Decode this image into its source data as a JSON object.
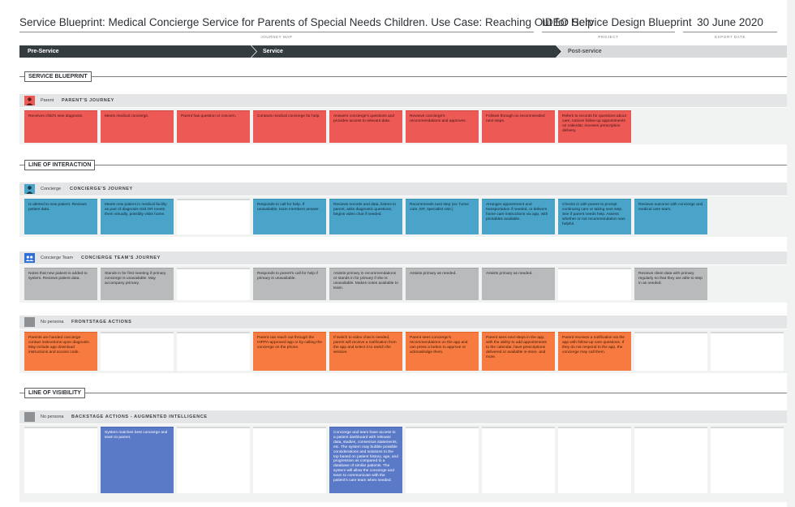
{
  "header": {
    "title": "Service Blueprint: Medical Concierge Service for Parents of Special Needs Children. Use Case: Reaching Out for Help",
    "title_caption": "JOURNEY MAP",
    "project": "IDEO Service Design Blueprint",
    "project_caption": "PROJECT",
    "date": "30 June 2020",
    "date_caption": "EXPORT DATE"
  },
  "phases": {
    "pre": "Pre-Service",
    "service": "Service",
    "post": "Post-service"
  },
  "sections": {
    "service_blueprint": "SERVICE BLUEPRINT",
    "line_of_interaction": "LINE OF INTERACTION",
    "line_of_visibility": "LINE OF VISIBILITY"
  },
  "lanes": {
    "parent": {
      "persona": "Parent",
      "title": "PARENT'S JOURNEY",
      "icon": "parent-avatar-icon",
      "color": "#ed5a56",
      "cards": [
        "Receives child's new diagnosis.",
        "Meets medical concierge.",
        "Parent has question or concern.",
        "Contacts medical concierge for help.",
        "Answers concierge's questions and provides access to relevant data.",
        "Reviews concierge's recommendations and approves.",
        "Follows through on recommended next steps.",
        "Refers to records for questions about care, notices follow-up appointments on calendar, receives prescription delivery."
      ]
    },
    "concierge": {
      "persona": "Concierge",
      "title": "CONCIERGE'S JOURNEY",
      "icon": "concierge-avatar-icon",
      "color": "#4aa3c9",
      "cards": [
        "Is alerted to new patient. Reviews patient data.",
        "Meets new patient in medical facility as part of diagnosis visit OR meets them virtually, possibly visits home.",
        "",
        "Responds to call for help. If unavailable, team members answer.",
        "Reviews records and data, listens to parent, asks diagnostic questions, begins video chat if needed.",
        "Recommends next step (ex: home care, ER, specialist visit.)",
        "Arranges appointment and transportation if needed, or delivers home care instructions via app, with printables available.",
        "Checks in with parent to prompt continuing care or taking next step. See if parent needs help. Assess whether or not recommendation was helpful.",
        "Reviews outcome with concierge and medical care team."
      ]
    },
    "team": {
      "persona": "Concierge Team",
      "title": "CONCIERGE TEAM'S JOURNEY",
      "icon": "team-icon",
      "color": "#2f6fd6",
      "cards": [
        "Notes that new patient is added to system. Reviews patient data.",
        "Stands in for first meeting if primary concierge is unavailable. May accompany primary.",
        "",
        "Responds to parent's call for help if primary is unavailable.",
        "Assists primary in recommendations or stands in for primary if she is unavailable. Makes notes available to team.",
        "Assists primary as needed.",
        "Assists primary as needed.",
        "",
        "Reviews client data with primary regularly so that they are able to step in as needed."
      ]
    },
    "frontstage": {
      "persona": "No persona",
      "title": "FRONTSTAGE ACTIONS",
      "icon": "no-persona-icon",
      "color": "#f77b40",
      "cards": [
        "Parents are handed concierge contact instructions upon diagnosis. May include app download instructions and access code.",
        "",
        "",
        "Parent can reach out through the HIPPA-approved app or by calling the concierge on the phone.",
        "If switch to video chat is needed, parent will receive a notification from the app and select it to switch the session.",
        "Parent sees concierge's recommendations on the app and can press a button to approve or acknowledge them.",
        "Parent sees next steps in the app, with the ability to add appointments to the calendar, have prescriptions delivered or available in-store, and more.",
        "Parent receives a notification via the app with follow-up care questions. If they do not respond to the app, the concierge may call them.",
        "",
        ""
      ]
    },
    "backstage": {
      "persona": "No persona",
      "title": "BACKSTAGE ACTIONS - AUGMENTED INTELLIGENCE",
      "icon": "no-persona-icon",
      "color": "#5a79c7",
      "cards": [
        "",
        "System matches best concierge and team to parent.",
        "",
        "",
        "Concierge and team have access to a patient dashboard with relevant data, studies, consensus statements, etc. The system may bubble possible considerations and solutions to the top based on patient history, age, and progression as compared to a database of similar patients. The system will allow the concierge and team to communicate with the patient's care team when needed.",
        "",
        "",
        "",
        "",
        ""
      ]
    }
  }
}
